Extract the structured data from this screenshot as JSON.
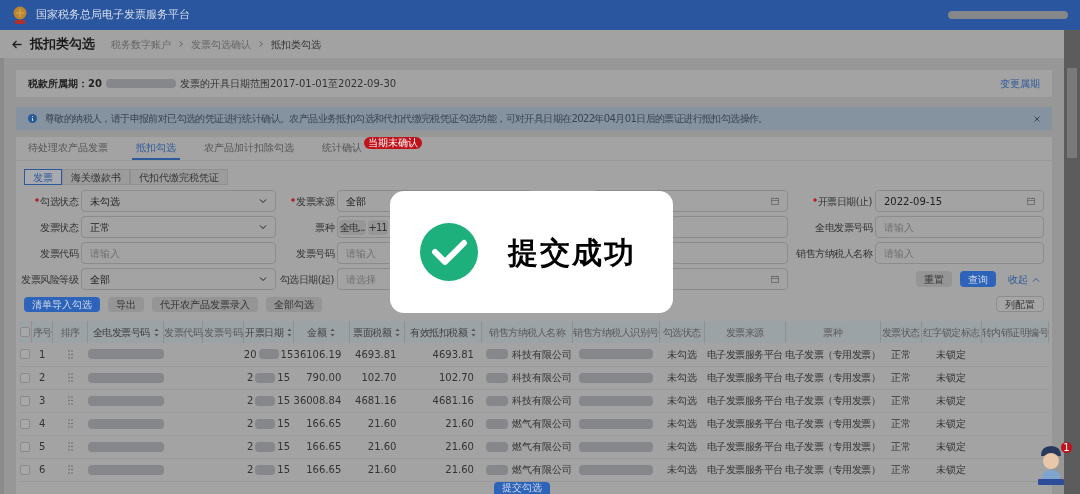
{
  "header": {
    "title": "国家税务总局电子发票服务平台"
  },
  "page": {
    "title": "抵扣类勾选",
    "breadcrumb": [
      "税务数字账户",
      "发票勾选确认",
      "抵扣类勾选"
    ]
  },
  "period": {
    "label": "税款所属期：",
    "value_start": "20",
    "range_text": "发票的开具日期范围2017-01-01至2022-09-30",
    "link": "变更属期"
  },
  "notice": {
    "text": "尊敬的纳税人，请于申报前对已勾选的凭证进行统计确认。农产品业务抵扣勾选和代扣代缴完税凭证勾选功能，可对开具日期在2022年04月01日后的票证进行抵扣勾选操作。"
  },
  "tabs": [
    {
      "label": "待处理农产品发票",
      "selected": false
    },
    {
      "label": "抵扣勾选",
      "selected": true
    },
    {
      "label": "农产品加计扣除勾选",
      "selected": false
    },
    {
      "label": "统计确认",
      "selected": false,
      "badge": "当期未确认"
    }
  ],
  "sub_tabs": [
    {
      "label": "发票",
      "selected": true
    },
    {
      "label": "海关缴款书",
      "selected": false
    },
    {
      "label": "代扣代缴完税凭证",
      "selected": false
    }
  ],
  "filters": [
    {
      "kind": "select",
      "label": "勾选状态",
      "required": true,
      "value": "未勾选"
    },
    {
      "kind": "select",
      "label": "发票来源",
      "required": true,
      "value": "全部"
    },
    {
      "kind": "date"
    },
    {
      "kind": "date",
      "label": "开票日期(止)",
      "required": true,
      "value": "2022-09-15"
    },
    {
      "kind": "select",
      "label": "发票状态",
      "required": false,
      "value": "正常"
    },
    {
      "kind": "tags",
      "label": "票种",
      "required": false,
      "tags": [
        "全电...",
        "+11"
      ]
    },
    {
      "kind": "input"
    },
    {
      "kind": "input",
      "label": "全电发票号码",
      "required": false,
      "placeholder": "请输入"
    },
    {
      "kind": "input",
      "label": "发票代码",
      "required": false,
      "placeholder": "请输入"
    },
    {
      "kind": "input",
      "label": "发票号码",
      "required": false,
      "placeholder": "请输入"
    },
    {
      "kind": "input"
    },
    {
      "kind": "input",
      "label": "销售方纳税人名称",
      "required": false,
      "placeholder": "请输入"
    },
    {
      "kind": "select",
      "label": "发票风险等级",
      "required": false,
      "value": "全部"
    },
    {
      "kind": "date",
      "label": "勾选日期(起)",
      "required": false,
      "placeholder": "请选择"
    },
    {
      "kind": "date"
    }
  ],
  "filter_actions": {
    "reset": "重置",
    "search": "查询",
    "collapse": "收起"
  },
  "actions": [
    {
      "label": "清单导入勾选",
      "primary": true
    },
    {
      "label": "导出",
      "primary": false
    },
    {
      "label": "代开农产品发票录入",
      "primary": false
    },
    {
      "label": "全部勾选",
      "primary": false
    }
  ],
  "column_config": "列配置",
  "table": {
    "all_checked": false,
    "columns": [
      {
        "label": "序号",
        "sortable": false
      },
      {
        "label": "排序",
        "sortable": false
      },
      {
        "label": "全电发票号码",
        "sortable": true
      },
      {
        "label": "发票代码",
        "sortable": false
      },
      {
        "label": "发票号码",
        "sortable": false
      },
      {
        "label": "开票日期",
        "sortable": true
      },
      {
        "label": "金额",
        "sortable": true
      },
      {
        "label": "票面税额",
        "sortable": true
      },
      {
        "label": "有效抵扣税额",
        "sortable": true
      },
      {
        "label": "销售方纳税人名称",
        "sortable": false
      },
      {
        "label": "销售方纳税人识别号",
        "sortable": false
      },
      {
        "label": "勾选状态",
        "sortable": false
      },
      {
        "label": "发票来源",
        "sortable": false
      },
      {
        "label": "票种",
        "sortable": false
      },
      {
        "label": "发票状态",
        "sortable": false
      },
      {
        "label": "红字锁定标志",
        "sortable": false
      },
      {
        "label": "转内销证明编号",
        "sortable": false
      }
    ],
    "rows": [
      {
        "index": "1",
        "checked": false,
        "date_start": "20",
        "date_end": "15",
        "amount": "36106.19",
        "tax": "4693.81",
        "deductible": "4693.81",
        "seller_name": "科技有限公司",
        "check_status": "未勾选",
        "source": "电子发票服务平台",
        "type": "电子发票（专用发票）",
        "status": "正常",
        "red_lock": "未锁定"
      },
      {
        "index": "2",
        "checked": false,
        "date_start": "2",
        "date_end": "15",
        "amount": "790.00",
        "tax": "102.70",
        "deductible": "102.70",
        "seller_name": "科技有限公司",
        "check_status": "未勾选",
        "source": "电子发票服务平台",
        "type": "电子发票（专用发票）",
        "status": "正常",
        "red_lock": "未锁定"
      },
      {
        "index": "3",
        "checked": false,
        "date_start": "2",
        "date_end": "15",
        "amount": "36008.84",
        "tax": "4681.16",
        "deductible": "4681.16",
        "seller_name": "科技有限公司",
        "check_status": "未勾选",
        "source": "电子发票服务平台",
        "type": "电子发票（专用发票）",
        "status": "正常",
        "red_lock": "未锁定"
      },
      {
        "index": "4",
        "checked": false,
        "date_start": "2",
        "date_end": "15",
        "amount": "166.65",
        "tax": "21.60",
        "deductible": "21.60",
        "seller_name": "燃气有限公司",
        "check_status": "未勾选",
        "source": "电子发票服务平台",
        "type": "电子发票（专用发票）",
        "status": "正常",
        "red_lock": "未锁定"
      },
      {
        "index": "5",
        "checked": false,
        "date_start": "2",
        "date_end": "15",
        "amount": "166.65",
        "tax": "21.60",
        "deductible": "21.60",
        "seller_name": "燃气有限公司",
        "check_status": "未勾选",
        "source": "电子发票服务平台",
        "type": "电子发票（专用发票）",
        "status": "正常",
        "red_lock": "未锁定"
      },
      {
        "index": "6",
        "checked": false,
        "date_start": "2",
        "date_end": "15",
        "amount": "166.65",
        "tax": "21.60",
        "deductible": "21.60",
        "seller_name": "燃气有限公司",
        "check_status": "未勾选",
        "source": "电子发票服务平台",
        "type": "电子发票（专用发票）",
        "status": "正常",
        "red_lock": "未锁定"
      }
    ]
  },
  "submit_button": "提交勾选",
  "assistant": {
    "badge": "1"
  },
  "toast": {
    "text": "提交成功"
  }
}
